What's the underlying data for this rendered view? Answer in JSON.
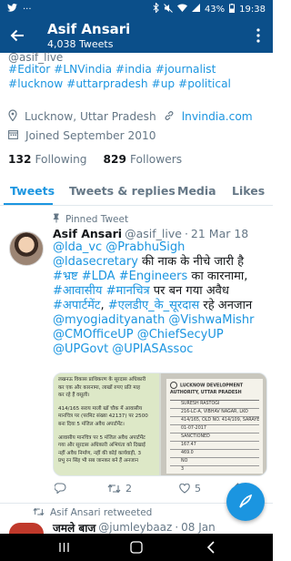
{
  "status_bar": {
    "battery": "43%",
    "time": "19:38"
  },
  "header": {
    "title": "Asif Ansari",
    "subtitle": "4,038 Tweets"
  },
  "profile": {
    "handle_partial": "@asif_live",
    "bio_hashtags": [
      "#Editor",
      "#LNVindia",
      "#india",
      "#journalist",
      "#lucknow",
      "#uttarpradesh",
      "#up",
      "#political"
    ],
    "location": "Lucknow, Uttar Pradesh",
    "website": "lnvindia.com",
    "joined": "Joined September 2010",
    "following_count": "132",
    "following_label": "Following",
    "followers_count": "829",
    "followers_label": "Followers"
  },
  "tabs": [
    {
      "label": "Tweets",
      "active": true
    },
    {
      "label": "Tweets & replies",
      "active": false
    },
    {
      "label": "Media",
      "active": false
    },
    {
      "label": "Likes",
      "active": false
    }
  ],
  "pinned_tweet": {
    "pinned_label": "Pinned Tweet",
    "author_name": "Asif Ansari",
    "author_handle": "@asif_live",
    "separator": "·",
    "date": "21 Mar 18",
    "text_line1_mentions": "@lda_vc @PrabhuSigh @ldasecretary",
    "text_line1_plain": " की",
    "text_line2": "नाक के नीचे जारी है ",
    "tag_bhrasht": "#भ्रष्ट",
    "tag_lda_engineers": "#LDA #Engineers",
    "text_line2_end": " का",
    "text_line3_start": "कारनामा, ",
    "tag_awasiya": "#आवासीय",
    "tag_manchitra": "#मानचित्र",
    "text_line3_mid": " पर बन गया अवैध",
    "tag_apartment": "#अपार्टमेंट",
    "text_comma": ", ",
    "tag_surdas": "#एलडीए_के_सूरदास",
    "text_line4_end": " रहे अनजान",
    "mentions_tail": "@myogiadityanath @VishwaMishr @CMOfficeUP @ChiefSecyUP @UPGovt @UPIASAssoc",
    "replies": "",
    "retweets": "2",
    "likes": "5"
  },
  "media": {
    "left_text_1": "लखनऊ विकास प्राधिकरण के सूरदास अधिकारी",
    "left_text_2": "कर एक और कारनामा, लाखों रुपए प्रति माह",
    "left_text_3": "कर रहे हैं वसूली।",
    "left_text_4": "414/165 सराय माली खाँ चौक में आवासीय",
    "left_text_5": "मानचित्र पर (परमिट संख्या 42137) पर 2500",
    "left_text_6": "बना दिया 5 मंजिल अवैध अपार्टमेंट।",
    "left_text_7": "आवासीय मानचित्र पर 5 मंजिल अवैध अपार्टमेंट",
    "left_text_8": "गया और सूरदास अधिकारी अभियंता को दिखाई",
    "left_text_9": "नहीं अवैध निर्माण, नहीं की कोई कार्यवाही, 3",
    "left_text_10": "प्रभु रन सिंह भी सब जानकर बने हैं अनजान",
    "doc_heading": "LUCKNOW DEVELOPMENT AUTHORITY, UTTAR PRADESH",
    "doc_row_1": "SURESH RASTOGI",
    "doc_row_2": "216-LC-A, VIBHAV NAGAR, LKO",
    "doc_row_3": "414/165, OLD NO. 414/109, SARAYE MALI KHAN, CHOWK",
    "doc_row_4": "01-07-2017",
    "doc_row_5": "SANCTIONED",
    "doc_row_6": "167.47",
    "doc_row_7": "469.0",
    "doc_row_8": "NO",
    "doc_row_9": "3",
    "doc_row_10": "42137"
  },
  "next_tweet": {
    "retweet_label": "Asif Ansari retweeted",
    "author_name": "जमले बाज",
    "author_handle": "@jumleybaaz",
    "separator": "·",
    "date": "08 Jan"
  },
  "colors": {
    "header_bg": "#0b4f8a",
    "accent": "#1b95e0",
    "secondary_text": "#657786"
  }
}
